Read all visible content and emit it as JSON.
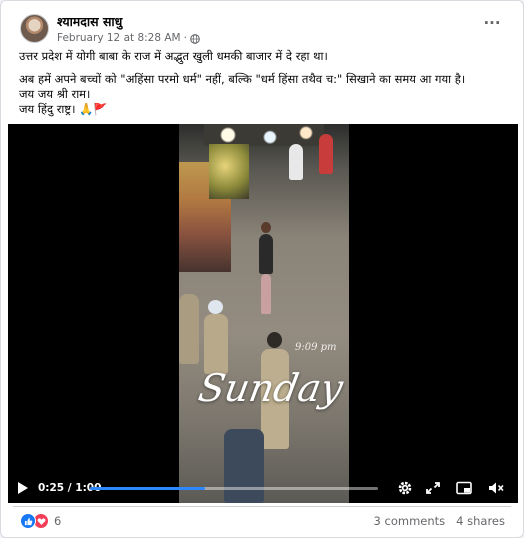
{
  "post": {
    "author": "श्यामदास साधु",
    "date": "February 12 at 8:28 AM",
    "privacy_icon": "globe-icon",
    "menu_icon": "more-options-icon",
    "lines": [
      "उत्तर प्रदेश में योगी बाबा के राज में अद्भुत खुली धमकी बाजार में दे रहा था।",
      "अब हमें अपने बच्चों को  \"अहिंसा परमो धर्म\" नहीं, बल्कि \"धर्म हिंसा तथैव च:\" सिखाने का समय आ गया है।",
      "जय जय श्री राम।",
      "जय हिंदु राष्ट्र। 🙏🚩"
    ]
  },
  "video": {
    "overlay_time": "9:09 pm",
    "overlay_day": "Sunday",
    "elapsed": "0:25",
    "total": "1:00",
    "time_display": "0:25 / 1:00",
    "progress": 0.4,
    "icons": [
      "play-icon",
      "settings-icon",
      "fullscreen-icon",
      "picture-in-picture-icon",
      "volume-icon"
    ]
  },
  "footer": {
    "reaction_icons": [
      "like-icon",
      "love-icon"
    ],
    "reaction_count": "6",
    "comments": "3 comments",
    "shares": "4 shares"
  },
  "colors": {
    "accent": "#1877f2",
    "love": "#f33e58",
    "progress": "#2d88ff",
    "muted": "#65676b"
  }
}
